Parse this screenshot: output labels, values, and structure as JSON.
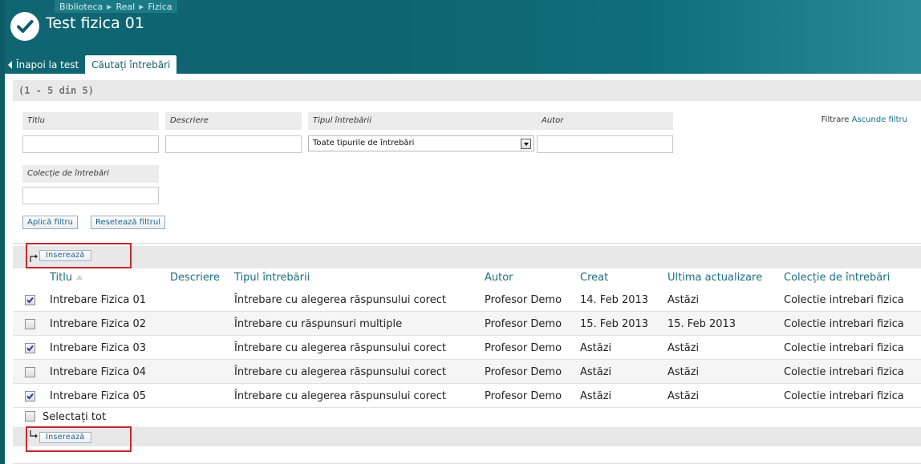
{
  "breadcrumbs": [
    "Biblioteca",
    "Real",
    "Fizica"
  ],
  "page_title": "Test fizica 01",
  "tabs": {
    "back": "Înapoi la test",
    "active": "Căutați întrebări"
  },
  "count_text": "(1 - 5 din 5)",
  "filters": {
    "title_label": "Titlu",
    "description_label": "Descriere",
    "type_label": "Tipul întrebării",
    "type_selected": "Toate tipurile de întrebări",
    "author_label": "Autor",
    "collection_label": "Colecție de întrebări",
    "toggle_prefix": "Filtrare",
    "toggle_link": "Ascunde filtru",
    "apply_button": "Aplică filtru",
    "reset_button": "Resetează filtrul"
  },
  "insert_button": "Inserează",
  "table": {
    "columns": [
      "Titlu",
      "Descriere",
      "Tipul întrebării",
      "Autor",
      "Creat",
      "Ultima actualizare",
      "Colecție de întrebări"
    ],
    "rows": [
      {
        "checked": true,
        "title": "Intrebare Fizica 01",
        "description": "",
        "type": "Întrebare cu alegerea răspunsului corect",
        "author": "Profesor Demo",
        "created": "14. Feb 2013",
        "updated": "Astăzi",
        "collection": "Colectie intrebari fizica"
      },
      {
        "checked": false,
        "title": "Intrebare Fizica 02",
        "description": "",
        "type": "Întrebare cu răspunsuri multiple",
        "author": "Profesor Demo",
        "created": "15. Feb 2013",
        "updated": "15. Feb 2013",
        "collection": "Colectie intrebari fizica"
      },
      {
        "checked": true,
        "title": "Intrebare Fizica 03",
        "description": "",
        "type": "Întrebare cu alegerea răspunsului corect",
        "author": "Profesor Demo",
        "created": "Astăzi",
        "updated": "Astăzi",
        "collection": "Colectie intrebari fizica"
      },
      {
        "checked": false,
        "title": "Intrebare Fizica 04",
        "description": "",
        "type": "Întrebare cu alegerea răspunsului corect",
        "author": "Profesor Demo",
        "created": "Astăzi",
        "updated": "Astăzi",
        "collection": "Colectie intrebari fizica"
      },
      {
        "checked": true,
        "title": "Intrebare Fizica 05",
        "description": "",
        "type": "Întrebare cu alegerea răspunsului corect",
        "author": "Profesor Demo",
        "created": "Astăzi",
        "updated": "Astăzi",
        "collection": "Colectie intrebari fizica"
      }
    ]
  },
  "select_all_label": "Selectați tot",
  "colors": {
    "header": "#0f6672",
    "link": "#1d6d85",
    "highlight_frame": "#c8262c"
  },
  "icons": [
    "check-circle-icon",
    "back-arrow-icon",
    "dropdown-arrow-icon",
    "insert-arrow-up-icon",
    "insert-arrow-down-icon",
    "sort-ascending-icon",
    "checkbox-icon"
  ]
}
